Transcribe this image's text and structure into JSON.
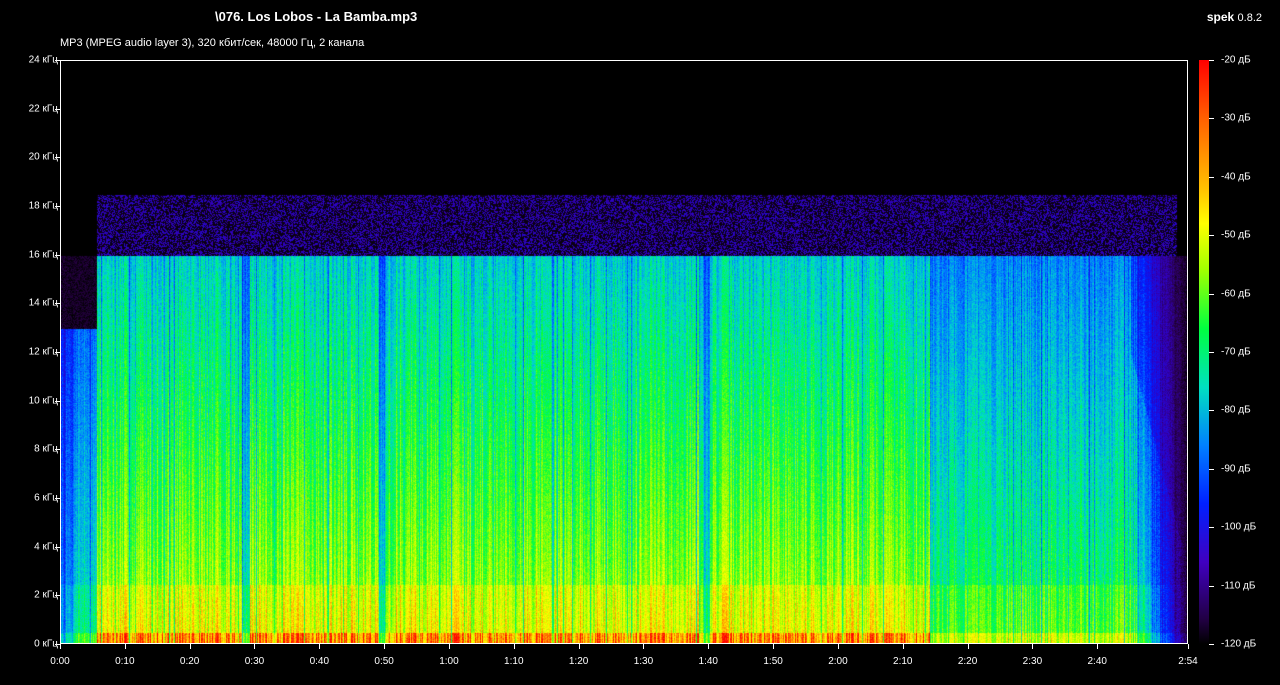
{
  "window": {
    "file_title": "\\076. Los Lobos - La Bamba.mp3",
    "app_name": "spek",
    "app_version": "0.8.2",
    "audio_info": "MP3 (MPEG audio layer 3), 320 кбит/сек, 48000 Гц, 2 канала"
  },
  "axes": {
    "frequency_labels": [
      "24 кГц",
      "22 кГц",
      "20 кГц",
      "18 кГц",
      "16 кГц",
      "14 кГц",
      "12 кГц",
      "10 кГц",
      "8 кГц",
      "6 кГц",
      "4 кГц",
      "2 кГц",
      "0 кГц"
    ],
    "time_labels": [
      "0:00",
      "0:10",
      "0:20",
      "0:30",
      "0:40",
      "0:50",
      "1:00",
      "1:10",
      "1:20",
      "1:30",
      "1:40",
      "1:50",
      "2:00",
      "2:10",
      "2:20",
      "2:30",
      "2:40",
      "2:54"
    ],
    "db_labels": [
      "-20 дБ",
      "-30 дБ",
      "-40 дБ",
      "-50 дБ",
      "-60 дБ",
      "-70 дБ",
      "-80 дБ",
      "-90 дБ",
      "-100 дБ",
      "-110 дБ",
      "-120 дБ"
    ]
  },
  "spectrum": {
    "duration_seconds": 174,
    "max_frequency_khz": 24,
    "lowpass_cutoff_khz": 16,
    "sparse_content_ceiling_khz": 18.5,
    "quiet_gaps_seconds": [
      28.5,
      49.5,
      99.5
    ],
    "loud_section_end_seconds": 134,
    "fade_start_seconds": 165
  },
  "colors": {
    "background": "#000000",
    "foreground": "#ffffff"
  }
}
